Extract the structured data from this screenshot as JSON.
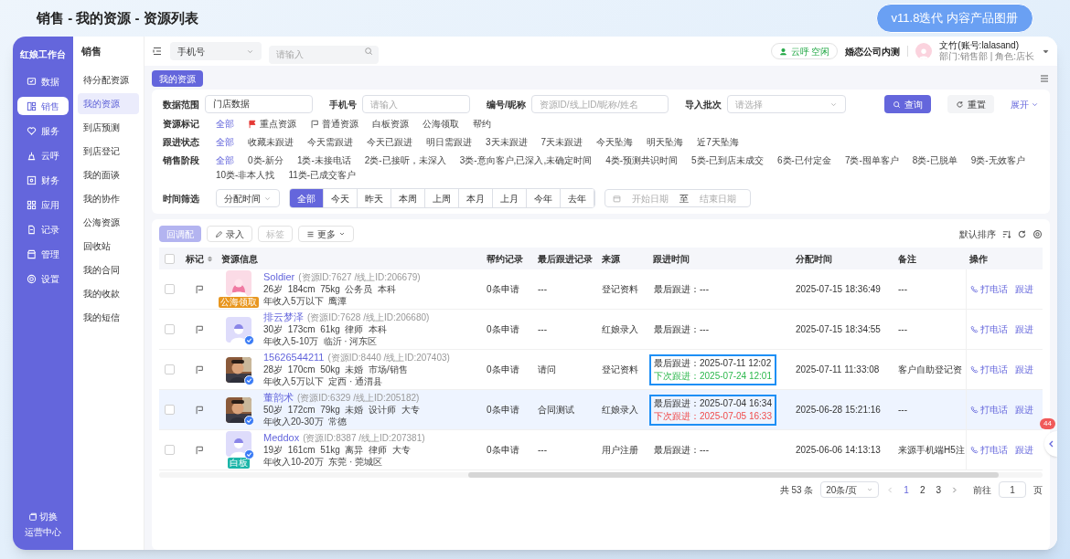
{
  "page_title": "销售 - 我的资源 - 资源列表",
  "version_badge": "v11.8迭代 内容产品图册",
  "nav": {
    "title": "红娘工作台",
    "items": [
      {
        "label": "数据",
        "selected": false
      },
      {
        "label": "销售",
        "selected": true
      },
      {
        "label": "服务",
        "selected": false
      },
      {
        "label": "云呼",
        "selected": false
      },
      {
        "label": "财务",
        "selected": false
      },
      {
        "label": "应用",
        "selected": false
      },
      {
        "label": "记录",
        "selected": false
      },
      {
        "label": "管理",
        "selected": false
      },
      {
        "label": "设置",
        "selected": false
      }
    ],
    "switch_label": "切换",
    "center_label": "运营中心"
  },
  "subnav": {
    "title": "销售",
    "items": [
      {
        "label": "待分配资源",
        "selected": false
      },
      {
        "label": "我的资源",
        "selected": true
      },
      {
        "label": "到店预测",
        "selected": false
      },
      {
        "label": "到店登记",
        "selected": false
      },
      {
        "label": "我的面谈",
        "selected": false
      },
      {
        "label": "我的协作",
        "selected": false
      },
      {
        "label": "公海资源",
        "selected": false
      },
      {
        "label": "回收站",
        "selected": false
      },
      {
        "label": "我的合同",
        "selected": false
      },
      {
        "label": "我的收款",
        "selected": false
      },
      {
        "label": "我的短信",
        "selected": false
      }
    ]
  },
  "top_bar": {
    "search_type": "手机号",
    "search_placeholder": "请输入",
    "call_status": "云呼 空闲",
    "company": "婚恋公司内测",
    "user_name": "文竹(账号:lalasand)",
    "user_meta": "部门:销售部 | 角色:店长"
  },
  "page_tab": "我的资源",
  "filters": {
    "fields": [
      {
        "label": "数据范围",
        "value": "门店数据",
        "kind": "input"
      },
      {
        "label": "手机号",
        "placeholder": "请输入",
        "kind": "input"
      },
      {
        "label": "编号/昵称",
        "placeholder": "资源ID/线上ID/昵称/姓名",
        "kind": "input"
      },
      {
        "label": "导入批次",
        "placeholder": "请选择",
        "kind": "select"
      }
    ],
    "search_button": "查询",
    "reset_button": "重置",
    "expand_link": "展开",
    "tag_groups": [
      {
        "label": "资源标记",
        "options": [
          {
            "label": "全部",
            "selected": true,
            "kind": "text"
          },
          {
            "label": "重点资源",
            "selected": false,
            "kind": "flag"
          },
          {
            "label": "普通资源",
            "selected": false,
            "kind": "outline-flag"
          },
          {
            "label": "白板资源",
            "selected": false,
            "kind": "text"
          },
          {
            "label": "公海领取",
            "selected": false,
            "kind": "text"
          },
          {
            "label": "帮约",
            "selected": false,
            "kind": "text"
          }
        ]
      },
      {
        "label": "跟进状态",
        "options": [
          {
            "label": "全部",
            "selected": true,
            "kind": "text"
          },
          {
            "label": "收藏未跟进",
            "selected": false,
            "kind": "text"
          },
          {
            "label": "今天需跟进",
            "selected": false,
            "kind": "text"
          },
          {
            "label": "今天已跟进",
            "selected": false,
            "kind": "text"
          },
          {
            "label": "明日需跟进",
            "selected": false,
            "kind": "text"
          },
          {
            "label": "3天未跟进",
            "selected": false,
            "kind": "text"
          },
          {
            "label": "7天未跟进",
            "selected": false,
            "kind": "text"
          },
          {
            "label": "今天坠海",
            "selected": false,
            "kind": "text"
          },
          {
            "label": "明天坠海",
            "selected": false,
            "kind": "text"
          },
          {
            "label": "近7天坠海",
            "selected": false,
            "kind": "text"
          }
        ]
      },
      {
        "label": "销售阶段",
        "options": [
          {
            "label": "全部",
            "selected": true,
            "kind": "text"
          },
          {
            "label": "0类-新分",
            "selected": false,
            "kind": "text"
          },
          {
            "label": "1类-未接电话",
            "selected": false,
            "kind": "text"
          },
          {
            "label": "2类-已接听，未深入",
            "selected": false,
            "kind": "text"
          },
          {
            "label": "3类-意向客户,已深入,未确定时间",
            "selected": false,
            "kind": "text"
          },
          {
            "label": "4类-预测共识时间",
            "selected": false,
            "kind": "text"
          },
          {
            "label": "5类-已到店未成交",
            "selected": false,
            "kind": "text"
          },
          {
            "label": "6类-已付定金",
            "selected": false,
            "kind": "text"
          },
          {
            "label": "7类-囤单客户",
            "selected": false,
            "kind": "text"
          },
          {
            "label": "8类-已脱单",
            "selected": false,
            "kind": "text"
          },
          {
            "label": "9类-无效客户",
            "selected": false,
            "kind": "text"
          },
          {
            "label": "10类-非本人找",
            "selected": false,
            "kind": "text"
          },
          {
            "label": "11类-已成交客户",
            "selected": false,
            "kind": "text"
          }
        ]
      }
    ],
    "time_filter": {
      "label": "时间筛选",
      "type": "分配时间",
      "ranges": [
        {
          "label": "全部",
          "selected": true
        },
        {
          "label": "今天",
          "selected": false
        },
        {
          "label": "昨天",
          "selected": false
        },
        {
          "label": "本周",
          "selected": false
        },
        {
          "label": "上周",
          "selected": false
        },
        {
          "label": "本月",
          "selected": false
        },
        {
          "label": "上月",
          "selected": false
        },
        {
          "label": "今年",
          "selected": false
        },
        {
          "label": "去年",
          "selected": false
        }
      ],
      "start_placeholder": "开始日期",
      "separator": "至",
      "end_placeholder": "结束日期"
    }
  },
  "toolbar": {
    "buttons": [
      {
        "label": "回调配",
        "kind": "primary",
        "disabled": true
      },
      {
        "label": "录入",
        "kind": "edit",
        "disabled": false
      },
      {
        "label": "标签",
        "kind": "plain",
        "disabled": true
      },
      {
        "label": "更多",
        "kind": "dropdown",
        "disabled": false
      }
    ],
    "sort_label": "默认排序"
  },
  "table": {
    "all_checked": false,
    "columns": [
      "标记",
      "资源信息",
      "帮约记录",
      "最后跟进记录",
      "来源",
      "跟进时间",
      "分配时间",
      "备注",
      "操作"
    ],
    "rows": [
      {
        "selected": false,
        "checked": false,
        "avatar": {
          "kind": "female-illustration"
        },
        "verified": false,
        "name": "Soldier",
        "ids": "(资源ID:7627 /线上ID:206679)",
        "details": "26岁  184cm  75kg  公务员  本科",
        "income": "年收入5万以下  鹰潭",
        "tag": {
          "label": "公海领取",
          "color": "#e8961e"
        },
        "applications": "0条申请",
        "last_record": "---",
        "source": "登记资料",
        "follow": {
          "last": "最后跟进：---",
          "highlighted": false
        },
        "assigned": "2025-07-15 18:36:49",
        "note": "---",
        "actions": [
          "打电话",
          "跟进"
        ]
      },
      {
        "selected": false,
        "checked": false,
        "avatar": {
          "kind": "male-illustration"
        },
        "verified": true,
        "name": "排云梦泽",
        "ids": "(资源ID:7628 /线上ID:206680)",
        "details": "30岁  173cm  61kg  律师  本科",
        "income": "年收入5-10万  临沂 · 河东区",
        "applications": "0条申请",
        "last_record": "---",
        "source": "红娘录入",
        "follow": {
          "last": "最后跟进：---",
          "highlighted": false
        },
        "assigned": "2025-07-15 18:34:55",
        "note": "---",
        "actions": [
          "打电话",
          "跟进"
        ]
      },
      {
        "selected": false,
        "checked": false,
        "avatar": {
          "kind": "picture"
        },
        "verified": true,
        "name": "15626544211",
        "ids": "(资源ID:8440 /线上ID:207403)",
        "details": "28岁  170cm  50kg  未婚  市场/销售",
        "income": "年收入5万以下  定西 · 通渭县",
        "applications": "0条申请",
        "last_record": "请问",
        "source": "登记资料",
        "follow": {
          "last": "最后跟进：2025-07-11 12:02",
          "next": "下次跟进：2025-07-24 12:01",
          "overdue": false,
          "highlighted": true
        },
        "assigned": "2025-07-11 11:33:08",
        "note": "客户自助登记资",
        "actions": [
          "打电话",
          "跟进"
        ]
      },
      {
        "selected": true,
        "checked": false,
        "avatar": {
          "kind": "picture"
        },
        "verified": true,
        "name": "董韵术",
        "ids": "(资源ID:6329 /线上ID:205182)",
        "details": "50岁  172cm  79kg  未婚  设计师  大专",
        "income": "年收入20-30万  常德",
        "applications": "0条申请",
        "last_record": "合同测试",
        "source": "红娘录入",
        "follow": {
          "last": "最后跟进：2025-07-04 16:34",
          "next": "下次跟进：2025-07-05 16:33",
          "overdue": true,
          "highlighted": true
        },
        "assigned": "2025-06-28 15:21:16",
        "note": "---",
        "actions": [
          "打电话",
          "跟进"
        ]
      },
      {
        "selected": false,
        "checked": false,
        "avatar": {
          "kind": "male-illustration"
        },
        "verified": true,
        "name": "Meddox",
        "ids": "(资源ID:8387 /线上ID:207381)",
        "details": "19岁  161cm  51kg  离异  律师  大专",
        "income": "年收入10-20万  东莞 · 莞城区",
        "tag": {
          "label": "白板",
          "color": "#1bb5a8"
        },
        "applications": "0条申请",
        "last_record": "---",
        "source": "用户注册",
        "follow": {
          "last": "最后跟进：---",
          "highlighted": false
        },
        "assigned": "2025-06-06 14:13:13",
        "note": "来源手机端H5注",
        "actions": [
          "打电话",
          "跟进"
        ]
      }
    ]
  },
  "pagination": {
    "total": "共 53 条",
    "page_size": "20条/页",
    "pages": [
      {
        "label": "1",
        "selected": true
      },
      {
        "label": "2",
        "selected": false
      },
      {
        "label": "3",
        "selected": false
      }
    ],
    "goto_label": "前往",
    "goto_value": "1",
    "goto_suffix": "页"
  },
  "float_badge": "44"
}
